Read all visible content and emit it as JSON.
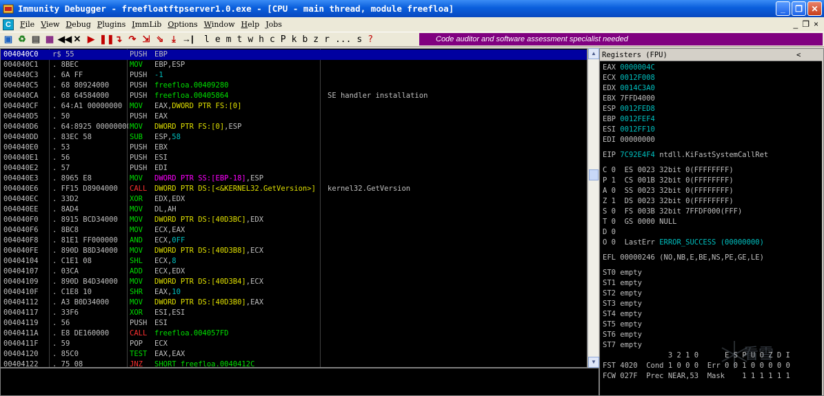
{
  "window": {
    "title": "Immunity Debugger - freefloatftpserver1.0.exe - [CPU - main thread, module freefloa]",
    "minimize": "_",
    "maximize": "❐",
    "close": "✕"
  },
  "menu": {
    "items": [
      {
        "accel": "F",
        "rest": "ile"
      },
      {
        "accel": "V",
        "rest": "iew"
      },
      {
        "accel": "D",
        "rest": "ebug"
      },
      {
        "accel": "P",
        "rest": "lugins"
      },
      {
        "accel": "I",
        "rest": "mmLib"
      },
      {
        "accel": "O",
        "rest": "ptions"
      },
      {
        "accel": "W",
        "rest": "indow"
      },
      {
        "accel": "H",
        "rest": "elp"
      },
      {
        "accel": "J",
        "rest": "obs"
      }
    ],
    "mdi_min": "_",
    "mdi_restore": "❐",
    "mdi_close": "×"
  },
  "toolbar": {
    "letters": [
      "l",
      "e",
      "m",
      "t",
      "w",
      "h",
      "c",
      "P",
      "k",
      "b",
      "z",
      "r",
      "...",
      "s",
      "?"
    ],
    "banner": "Code auditor and software assessment specialist needed"
  },
  "colors": {
    "white": "#c0c0c0",
    "cyan": "#00c0c0",
    "green": "#00e000",
    "yellow": "#e0e000",
    "red": "#ff3030",
    "magenta": "#ff00ff"
  },
  "cpu": {
    "rows": [
      {
        "addr": "004040C0",
        "hex": "r$ 55",
        "mnem": "PUSH",
        "mc": "white",
        "ops": [
          {
            "t": "EBP",
            "c": "white"
          }
        ],
        "comment": "",
        "selected": true
      },
      {
        "addr": "004040C1",
        "hex": ". 8BEC",
        "mnem": "MOV",
        "mc": "green",
        "ops": [
          {
            "t": "EBP,ESP",
            "c": "white"
          }
        ],
        "comment": ""
      },
      {
        "addr": "004040C3",
        "hex": ". 6A FF",
        "mnem": "PUSH",
        "mc": "white",
        "ops": [
          {
            "t": "-1",
            "c": "cyan"
          }
        ],
        "comment": ""
      },
      {
        "addr": "004040C5",
        "hex": ". 68 80924000",
        "mnem": "PUSH",
        "mc": "white",
        "ops": [
          {
            "t": "freefloa.00409280",
            "c": "green"
          }
        ],
        "comment": ""
      },
      {
        "addr": "004040CA",
        "hex": ". 68 64584000",
        "mnem": "PUSH",
        "mc": "white",
        "ops": [
          {
            "t": "freefloa.00405864",
            "c": "green"
          }
        ],
        "comment": "SE handler installation"
      },
      {
        "addr": "004040CF",
        "hex": ". 64:A1 00000000",
        "mnem": "MOV",
        "mc": "green",
        "ops": [
          {
            "t": "EAX,",
            "c": "white"
          },
          {
            "t": "DWORD PTR FS:[0]",
            "c": "yellow"
          }
        ],
        "comment": ""
      },
      {
        "addr": "004040D5",
        "hex": ". 50",
        "mnem": "PUSH",
        "mc": "white",
        "ops": [
          {
            "t": "EAX",
            "c": "white"
          }
        ],
        "comment": ""
      },
      {
        "addr": "004040D6",
        "hex": ". 64:8925 00000000",
        "mnem": "MOV",
        "mc": "green",
        "ops": [
          {
            "t": "DWORD PTR FS:[0]",
            "c": "yellow"
          },
          {
            "t": ",ESP",
            "c": "white"
          }
        ],
        "comment": ""
      },
      {
        "addr": "004040DD",
        "hex": ". 83EC 58",
        "mnem": "SUB",
        "mc": "green",
        "ops": [
          {
            "t": "ESP,",
            "c": "white"
          },
          {
            "t": "58",
            "c": "cyan"
          }
        ],
        "comment": ""
      },
      {
        "addr": "004040E0",
        "hex": ". 53",
        "mnem": "PUSH",
        "mc": "white",
        "ops": [
          {
            "t": "EBX",
            "c": "white"
          }
        ],
        "comment": ""
      },
      {
        "addr": "004040E1",
        "hex": ". 56",
        "mnem": "PUSH",
        "mc": "white",
        "ops": [
          {
            "t": "ESI",
            "c": "white"
          }
        ],
        "comment": ""
      },
      {
        "addr": "004040E2",
        "hex": ". 57",
        "mnem": "PUSH",
        "mc": "white",
        "ops": [
          {
            "t": "EDI",
            "c": "white"
          }
        ],
        "comment": ""
      },
      {
        "addr": "004040E3",
        "hex": ". 8965 E8",
        "mnem": "MOV",
        "mc": "green",
        "ops": [
          {
            "t": "DWORD PTR SS:[EBP-18]",
            "c": "magenta"
          },
          {
            "t": ",ESP",
            "c": "white"
          }
        ],
        "comment": ""
      },
      {
        "addr": "004040E6",
        "hex": ". FF15 D8904000",
        "mnem": "CALL",
        "mc": "red",
        "ops": [
          {
            "t": "DWORD PTR DS:[<&KERNEL32.GetVersion>]",
            "c": "yellow"
          }
        ],
        "comment": "kernel32.GetVersion"
      },
      {
        "addr": "004040EC",
        "hex": ". 33D2",
        "mnem": "XOR",
        "mc": "green",
        "ops": [
          {
            "t": "EDX,EDX",
            "c": "white"
          }
        ],
        "comment": ""
      },
      {
        "addr": "004040EE",
        "hex": ". 8AD4",
        "mnem": "MOV",
        "mc": "green",
        "ops": [
          {
            "t": "DL,AH",
            "c": "white"
          }
        ],
        "comment": ""
      },
      {
        "addr": "004040F0",
        "hex": ". 8915 BCD34000",
        "mnem": "MOV",
        "mc": "green",
        "ops": [
          {
            "t": "DWORD PTR DS:[40D3BC]",
            "c": "yellow"
          },
          {
            "t": ",EDX",
            "c": "white"
          }
        ],
        "comment": ""
      },
      {
        "addr": "004040F6",
        "hex": ". 8BC8",
        "mnem": "MOV",
        "mc": "green",
        "ops": [
          {
            "t": "ECX,EAX",
            "c": "white"
          }
        ],
        "comment": ""
      },
      {
        "addr": "004040F8",
        "hex": ". 81E1 FF000000",
        "mnem": "AND",
        "mc": "green",
        "ops": [
          {
            "t": "ECX,",
            "c": "white"
          },
          {
            "t": "0FF",
            "c": "cyan"
          }
        ],
        "comment": ""
      },
      {
        "addr": "004040FE",
        "hex": ". 890D B8D34000",
        "mnem": "MOV",
        "mc": "green",
        "ops": [
          {
            "t": "DWORD PTR DS:[40D3B8]",
            "c": "yellow"
          },
          {
            "t": ",ECX",
            "c": "white"
          }
        ],
        "comment": ""
      },
      {
        "addr": "00404104",
        "hex": ". C1E1 08",
        "mnem": "SHL",
        "mc": "green",
        "ops": [
          {
            "t": "ECX,",
            "c": "white"
          },
          {
            "t": "8",
            "c": "cyan"
          }
        ],
        "comment": ""
      },
      {
        "addr": "00404107",
        "hex": ". 03CA",
        "mnem": "ADD",
        "mc": "green",
        "ops": [
          {
            "t": "ECX,EDX",
            "c": "white"
          }
        ],
        "comment": ""
      },
      {
        "addr": "00404109",
        "hex": ". 890D B4D34000",
        "mnem": "MOV",
        "mc": "green",
        "ops": [
          {
            "t": "DWORD PTR DS:[40D3B4]",
            "c": "yellow"
          },
          {
            "t": ",ECX",
            "c": "white"
          }
        ],
        "comment": ""
      },
      {
        "addr": "0040410F",
        "hex": ". C1E8 10",
        "mnem": "SHR",
        "mc": "green",
        "ops": [
          {
            "t": "EAX,",
            "c": "white"
          },
          {
            "t": "10",
            "c": "cyan"
          }
        ],
        "comment": ""
      },
      {
        "addr": "00404112",
        "hex": ". A3 B0D34000",
        "mnem": "MOV",
        "mc": "green",
        "ops": [
          {
            "t": "DWORD PTR DS:[40D3B0]",
            "c": "yellow"
          },
          {
            "t": ",EAX",
            "c": "white"
          }
        ],
        "comment": ""
      },
      {
        "addr": "00404117",
        "hex": ". 33F6",
        "mnem": "XOR",
        "mc": "green",
        "ops": [
          {
            "t": "ESI,ESI",
            "c": "white"
          }
        ],
        "comment": ""
      },
      {
        "addr": "00404119",
        "hex": ". 56",
        "mnem": "PUSH",
        "mc": "white",
        "ops": [
          {
            "t": "ESI",
            "c": "white"
          }
        ],
        "comment": ""
      },
      {
        "addr": "0040411A",
        "hex": ". E8 DE160000",
        "mnem": "CALL",
        "mc": "red",
        "ops": [
          {
            "t": "freefloa.004057FD",
            "c": "green"
          }
        ],
        "comment": ""
      },
      {
        "addr": "0040411F",
        "hex": ". 59",
        "mnem": "POP",
        "mc": "white",
        "ops": [
          {
            "t": "ECX",
            "c": "white"
          }
        ],
        "comment": ""
      },
      {
        "addr": "00404120",
        "hex": ". 85C0",
        "mnem": "TEST",
        "mc": "green",
        "ops": [
          {
            "t": "EAX,EAX",
            "c": "white"
          }
        ],
        "comment": ""
      },
      {
        "addr": "00404122",
        "hex": ". 75 08",
        "mnem": "JNZ",
        "mc": "red",
        "ops": [
          {
            "t": "SHORT freefloa.0040412C",
            "c": "green"
          }
        ],
        "comment": ""
      }
    ]
  },
  "registers": {
    "header": "Registers (FPU)",
    "header_arrow": "<",
    "lines": [
      {
        "a": "EAX ",
        "b": "0000004C",
        "c": "",
        "hl": true
      },
      {
        "a": "ECX ",
        "b": "0012F008",
        "c": "",
        "hl": true
      },
      {
        "a": "EDX ",
        "b": "0014C3A0",
        "c": "",
        "hl": true
      },
      {
        "a": "EBX ",
        "b": "7FFD4000",
        "c": "",
        "hl": false
      },
      {
        "a": "ESP ",
        "b": "0012FED8",
        "c": "",
        "hl": true
      },
      {
        "a": "EBP ",
        "b": "0012FEF4",
        "c": "",
        "hl": true
      },
      {
        "a": "ESI ",
        "b": "0012FF10",
        "c": "",
        "hl": true
      },
      {
        "a": "EDI ",
        "b": "00000000",
        "c": "",
        "hl": false
      },
      {
        "a": "",
        "b": "",
        "c": "",
        "hl": false,
        "gap": true
      },
      {
        "a": "EIP ",
        "b": "7C92E4F4",
        "c": " ntdll.KiFastSystemCallRet",
        "hl": true
      },
      {
        "a": "",
        "b": "",
        "c": "",
        "hl": false,
        "gap": true
      },
      {
        "a": "C 0  ES 0023 32bit 0(FFFFFFFF)",
        "b": "",
        "c": "",
        "hl": false
      },
      {
        "a": "P 1  CS 001B 32bit 0(FFFFFFFF)",
        "b": "",
        "c": "",
        "hl": false
      },
      {
        "a": "A 0  SS 0023 32bit 0(FFFFFFFF)",
        "b": "",
        "c": "",
        "hl": false
      },
      {
        "a": "Z 1  DS 0023 32bit 0(FFFFFFFF)",
        "b": "",
        "c": "",
        "hl": false
      },
      {
        "a": "S 0  FS 003B 32bit 7FFDF000(FFF)",
        "b": "",
        "c": "",
        "hl": false
      },
      {
        "a": "T 0  GS 0000 NULL",
        "b": "",
        "c": "",
        "hl": false
      },
      {
        "a": "D 0",
        "b": "",
        "c": "",
        "hl": false
      },
      {
        "a": "O 0  LastErr ",
        "b": "ERROR_SUCCESS (00000000)",
        "c": "",
        "hl": true
      },
      {
        "a": "",
        "b": "",
        "c": "",
        "hl": false,
        "gap": true
      },
      {
        "a": "EFL 00000246 (NO,NB,E,BE,NS,PE,GE,LE)",
        "b": "",
        "c": "",
        "hl": false
      },
      {
        "a": "",
        "b": "",
        "c": "",
        "hl": false,
        "gap": true
      },
      {
        "a": "ST0 empty",
        "b": "",
        "c": "",
        "hl": false
      },
      {
        "a": "ST1 empty",
        "b": "",
        "c": "",
        "hl": false
      },
      {
        "a": "ST2 empty",
        "b": "",
        "c": "",
        "hl": false
      },
      {
        "a": "ST3 empty",
        "b": "",
        "c": "",
        "hl": false
      },
      {
        "a": "ST4 empty",
        "b": "",
        "c": "",
        "hl": false
      },
      {
        "a": "ST5 empty",
        "b": "",
        "c": "",
        "hl": false
      },
      {
        "a": "ST6 empty",
        "b": "",
        "c": "",
        "hl": false
      },
      {
        "a": "ST7 empty",
        "b": "",
        "c": "",
        "hl": false
      },
      {
        "a": "               3 2 1 0      E S P U O Z D I",
        "b": "",
        "c": "",
        "hl": false
      },
      {
        "a": "FST 4020  Cond 1 0 0 0  Err 0 0 1 0 0 0 0 0",
        "b": "",
        "c": "",
        "hl": false
      },
      {
        "a": "FCW 027F  Prec NEAR,53  Mask    1 1 1 1 1 1",
        "b": "",
        "c": "",
        "hl": false
      }
    ]
  },
  "watermark": "看雪"
}
